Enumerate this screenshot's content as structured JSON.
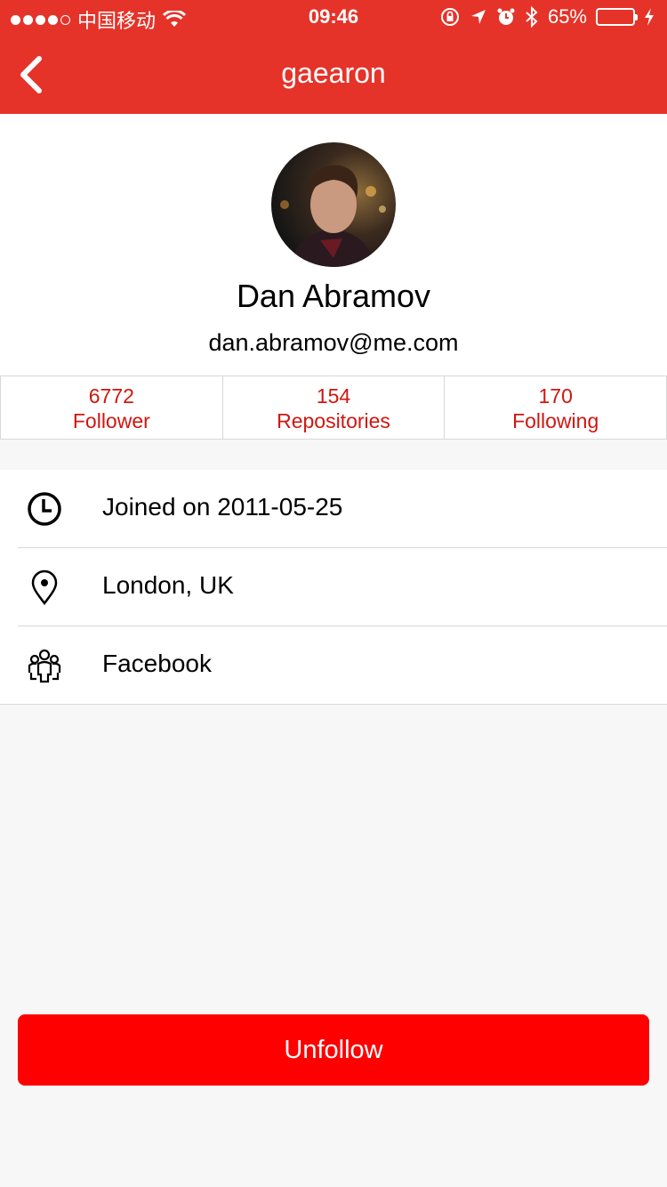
{
  "status_bar": {
    "carrier": "中国移动",
    "time": "09:46",
    "battery": "65%",
    "battery_level": 0.65
  },
  "nav": {
    "title": "gaearon"
  },
  "profile": {
    "name": "Dan Abramov",
    "email": "dan.abramov@me.com"
  },
  "stats": [
    {
      "count": "6772",
      "label": "Follower"
    },
    {
      "count": "154",
      "label": "Repositories"
    },
    {
      "count": "170",
      "label": "Following"
    }
  ],
  "info": [
    {
      "icon": "clock-icon",
      "text": "Joined on 2011-05-25"
    },
    {
      "icon": "location-pin-icon",
      "text": "London, UK"
    },
    {
      "icon": "group-icon",
      "text": "Facebook"
    }
  ],
  "actions": {
    "unfollow_label": "Unfollow"
  },
  "colors": {
    "primary": "#e53329",
    "stat_text": "#d0160f",
    "button": "#ff0000",
    "background": "#f7f7f7"
  }
}
